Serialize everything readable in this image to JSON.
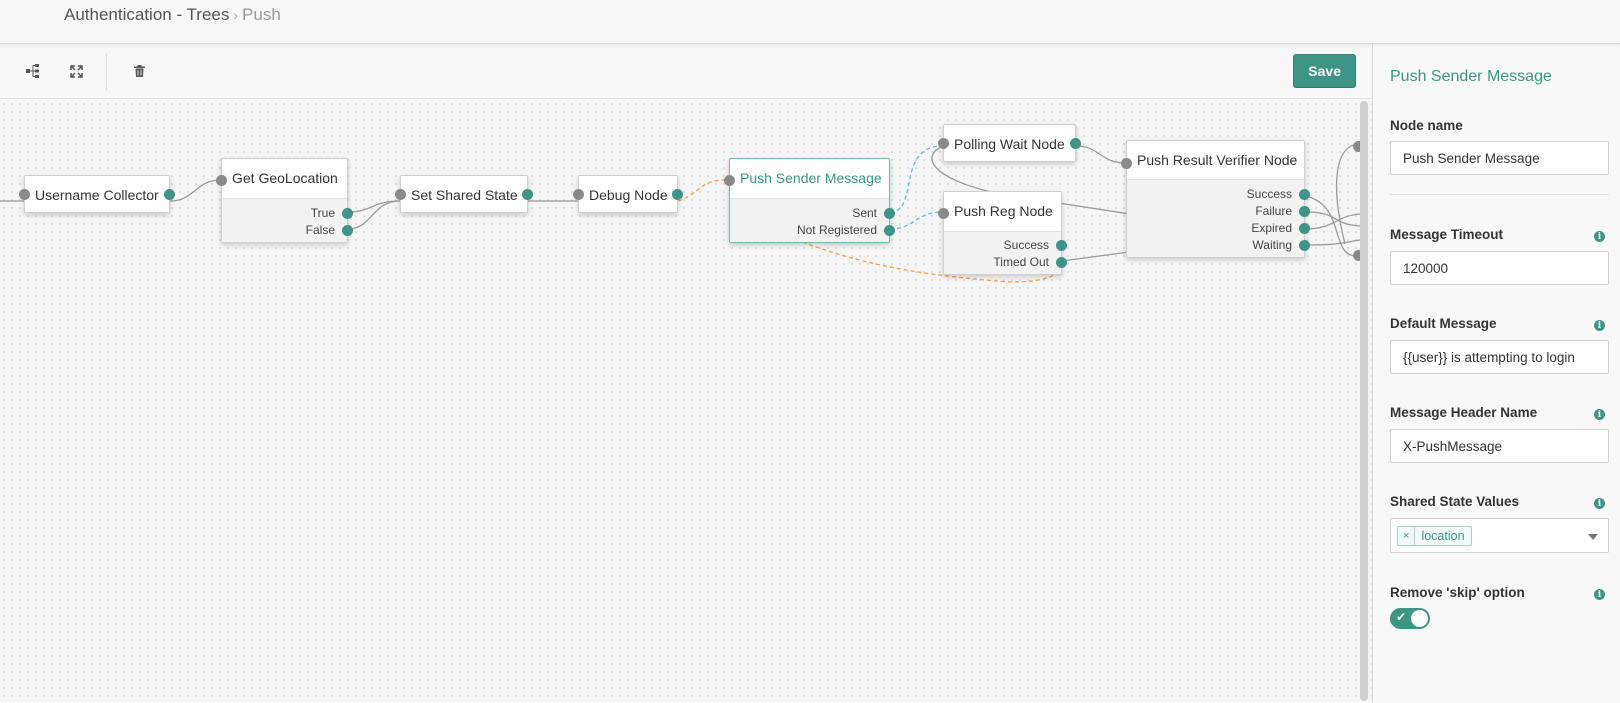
{
  "breadcrumb": {
    "root": "Authentication - Trees",
    "separator": "›",
    "current": "Push"
  },
  "toolbar": {
    "layout_icon": "tree-layout-icon",
    "fullscreen_icon": "expand-icon",
    "delete_icon": "trash-icon",
    "save_label": "Save"
  },
  "nodes": [
    {
      "title": "Username Collector",
      "outcomes": []
    },
    {
      "title": "Get GeoLocation",
      "outcomes": [
        "True",
        "False"
      ]
    },
    {
      "title": "Set Shared State",
      "outcomes": []
    },
    {
      "title": "Debug Node",
      "outcomes": []
    },
    {
      "title": "Push Sender Message",
      "outcomes": [
        "Sent",
        "Not Registered"
      ]
    },
    {
      "title": "Polling Wait Node",
      "outcomes": []
    },
    {
      "title": "Push Reg Node",
      "outcomes": [
        "Success",
        "Timed Out"
      ]
    },
    {
      "title": "Push Result Verifier Node",
      "outcomes": [
        "Success",
        "Failure",
        "Expired",
        "Waiting"
      ]
    }
  ],
  "panel": {
    "title": "Push Sender Message",
    "node_name_label": "Node name",
    "node_name_value": "Push Sender Message",
    "timeout_label": "Message Timeout",
    "timeout_value": "120000",
    "default_message_label": "Default Message",
    "default_message_value": "{{user}} is attempting to login",
    "header_name_label": "Message Header Name",
    "header_name_value": "X-PushMessage",
    "shared_state_label": "Shared State Values",
    "shared_state_chip": "location",
    "chip_remove": "×",
    "skip_label": "Remove 'skip' option",
    "skip_enabled": true,
    "info_glyph": "i"
  },
  "colors": {
    "accent": "#3e9485",
    "selected_edge": "#5bbad8",
    "orange_edge": "#f0a04b"
  }
}
